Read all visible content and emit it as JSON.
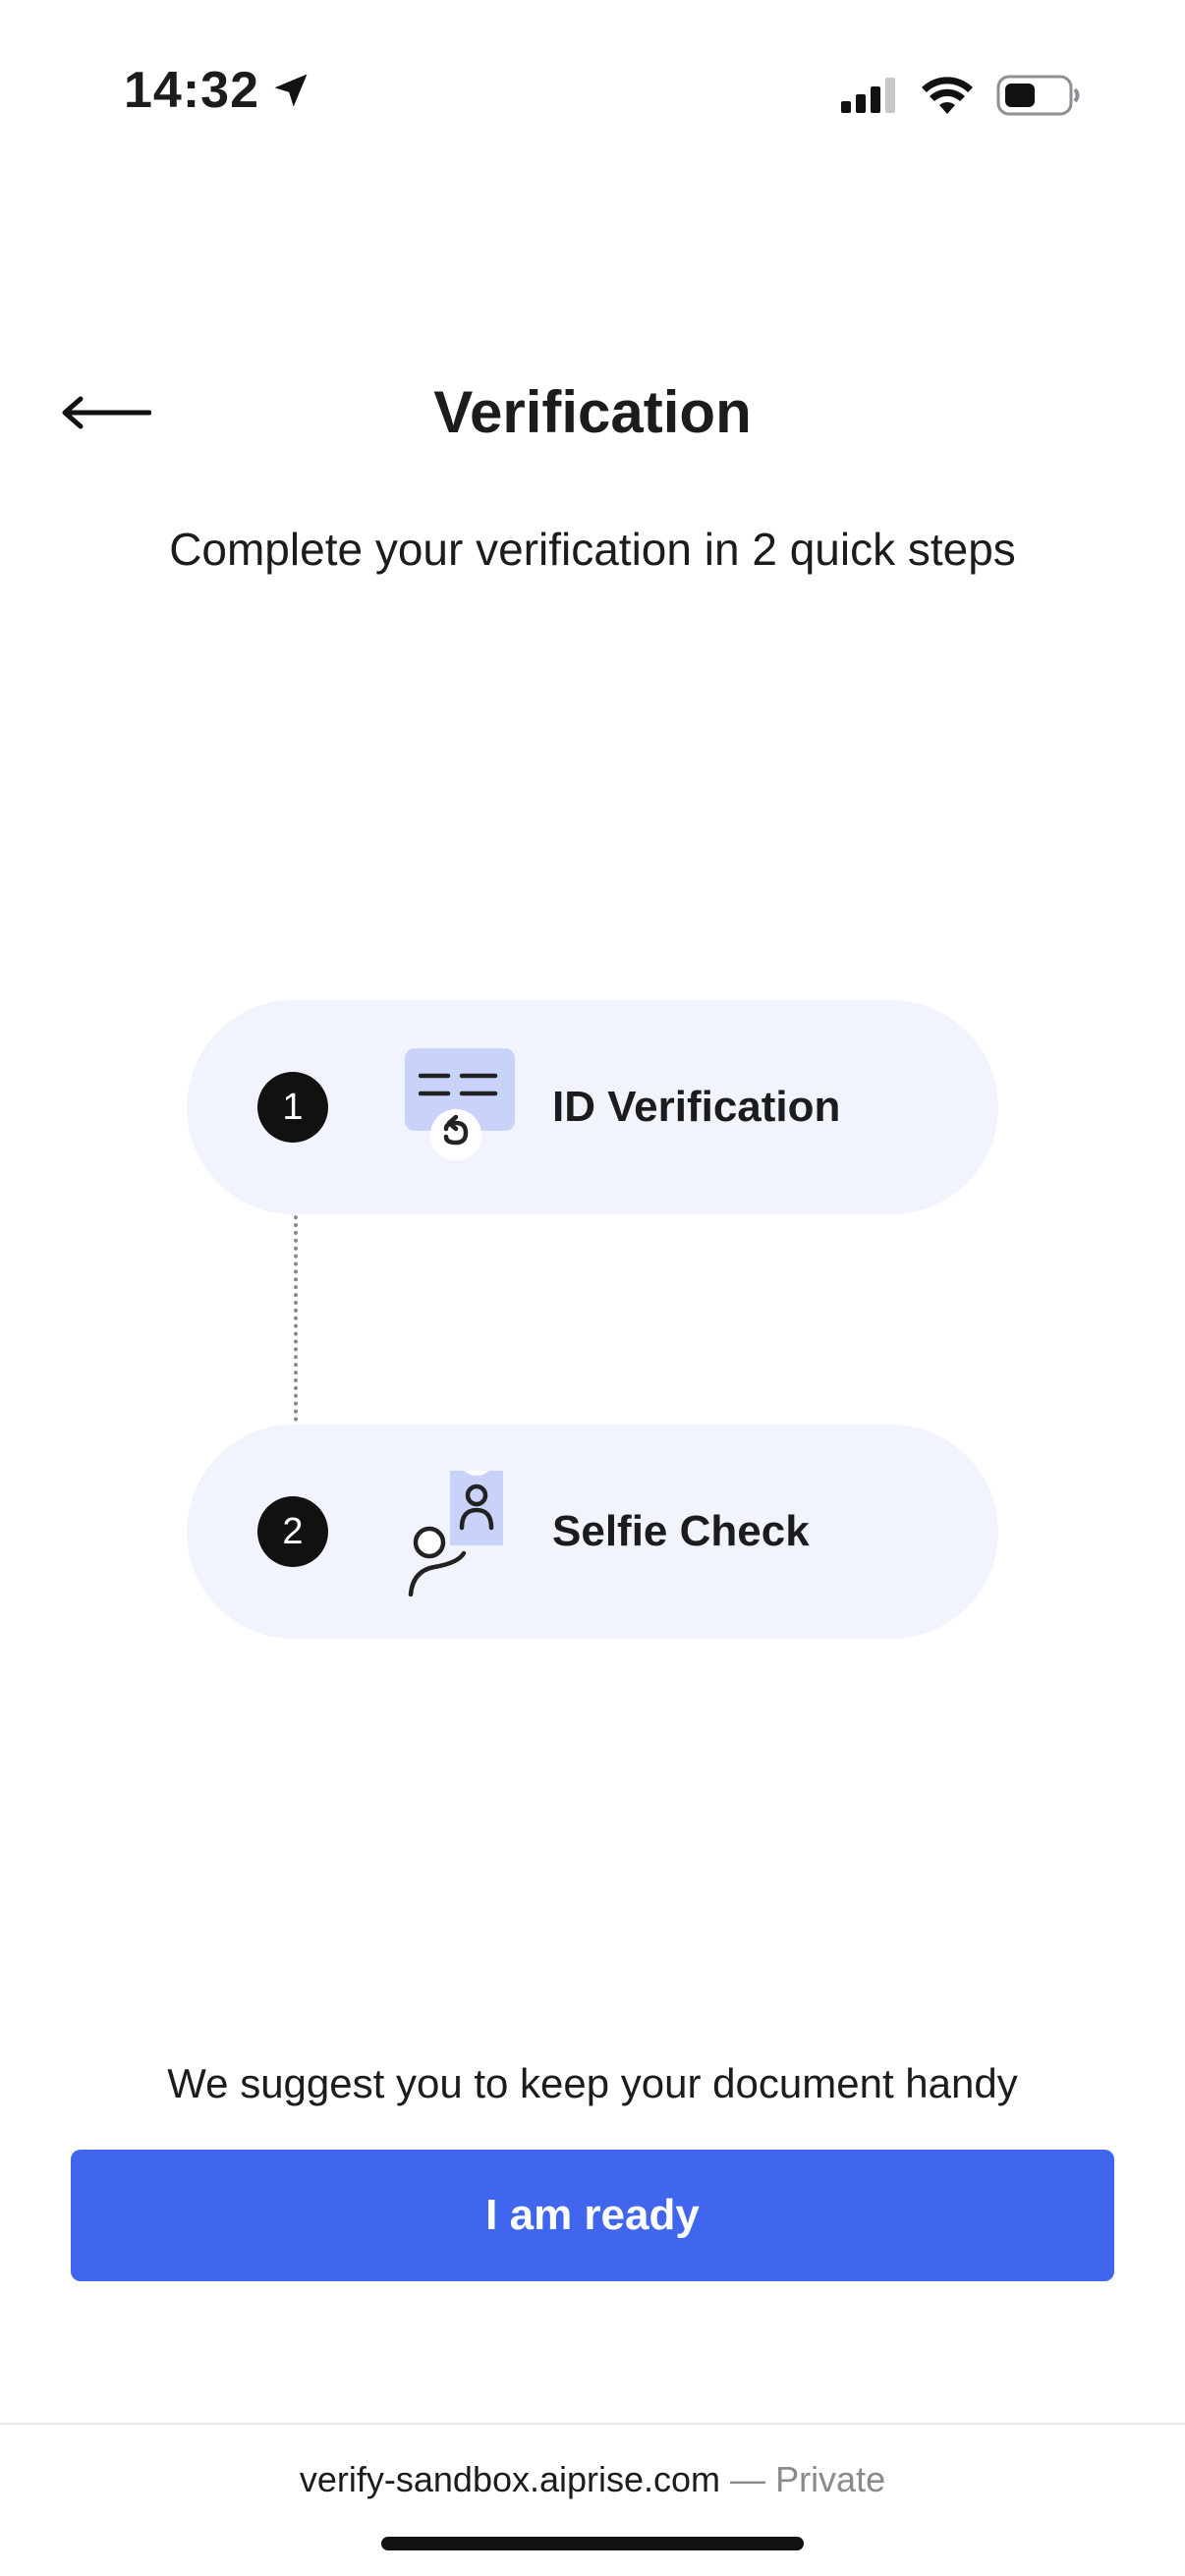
{
  "status_bar": {
    "time": "14:32"
  },
  "header": {
    "title": "Verification",
    "subtitle": "Complete your verification in 2 quick steps"
  },
  "steps": [
    {
      "number": "1",
      "label": "ID Verification",
      "icon": "id-card-icon"
    },
    {
      "number": "2",
      "label": "Selfie Check",
      "icon": "selfie-icon"
    }
  ],
  "footer": {
    "suggestion": "We suggest you to keep your document handy",
    "ready_label": "I am ready"
  },
  "browser": {
    "domain": "verify-sandbox.aiprise.com",
    "separator": " — ",
    "mode": "Private"
  },
  "colors": {
    "accent": "#4066ee",
    "pill_background": "#f1f4fd",
    "icon_fill": "#c9d3fa"
  }
}
